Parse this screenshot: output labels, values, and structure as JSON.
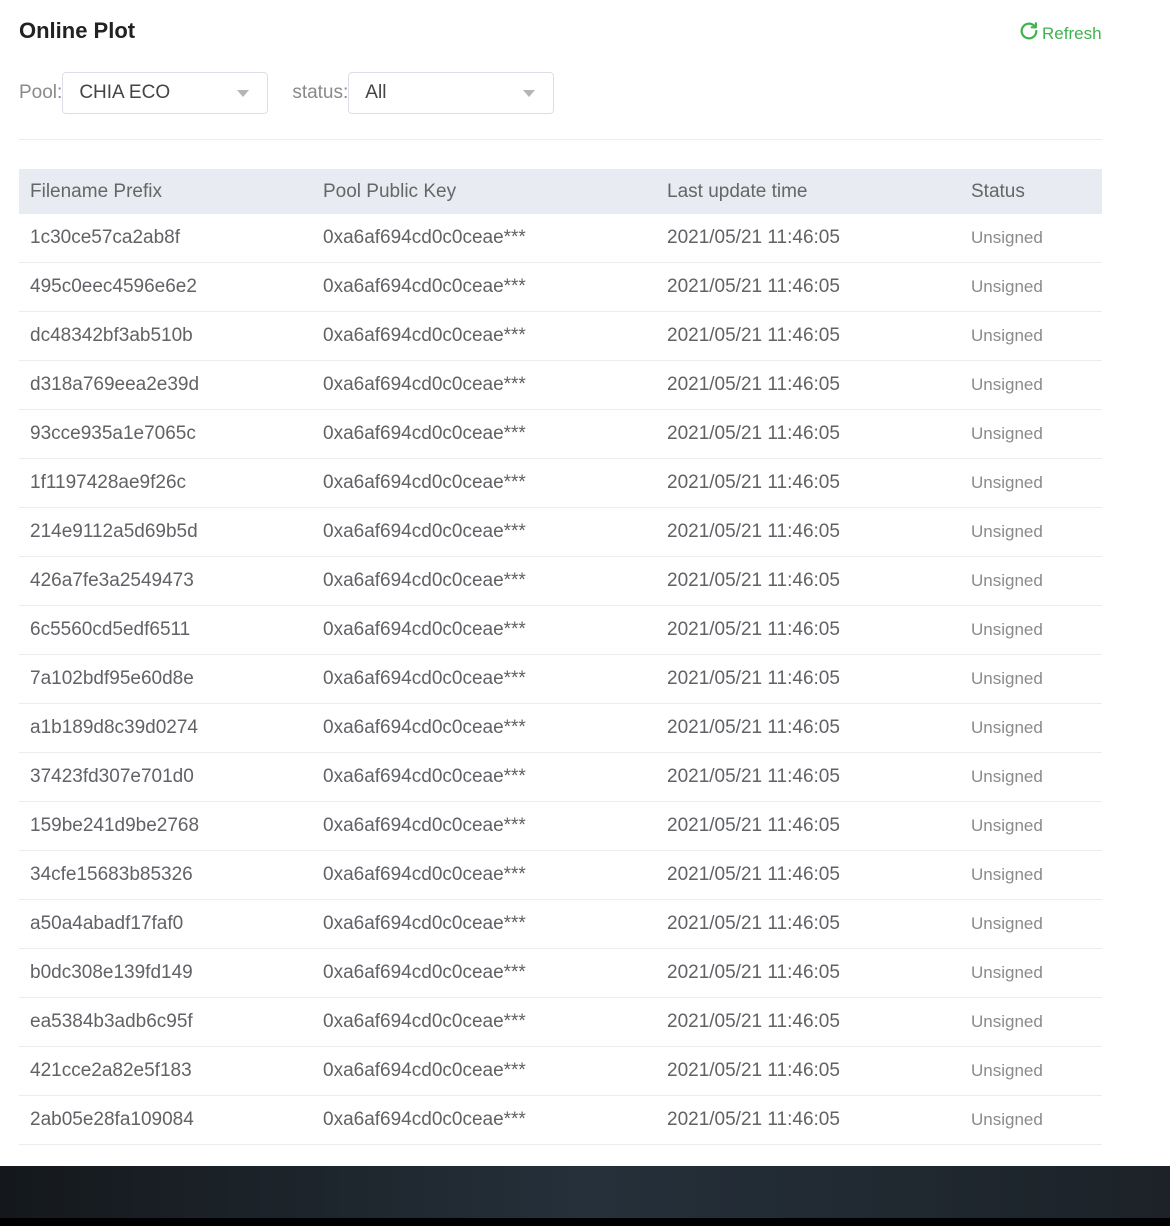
{
  "header": {
    "title": "Online Plot",
    "refresh_label": "Refresh"
  },
  "filters": {
    "pool": {
      "label": "Pool:",
      "value": "CHIA ECO"
    },
    "status": {
      "label": "status:",
      "value": "All"
    }
  },
  "colors": {
    "accent": "#3fb34f",
    "header_bg": "#e8ebf1"
  },
  "table": {
    "columns": [
      "Filename Prefix",
      "Pool Public Key",
      "Last update time",
      "Status"
    ],
    "rows": [
      [
        "1c30ce57ca2ab8f",
        "0xa6af694cd0c0ceae***",
        "2021/05/21 11:46:05",
        "Unsigned"
      ],
      [
        "495c0eec4596e6e2",
        "0xa6af694cd0c0ceae***",
        "2021/05/21 11:46:05",
        "Unsigned"
      ],
      [
        "dc48342bf3ab510b",
        "0xa6af694cd0c0ceae***",
        "2021/05/21 11:46:05",
        "Unsigned"
      ],
      [
        "d318a769eea2e39d",
        "0xa6af694cd0c0ceae***",
        "2021/05/21 11:46:05",
        "Unsigned"
      ],
      [
        "93cce935a1e7065c",
        "0xa6af694cd0c0ceae***",
        "2021/05/21 11:46:05",
        "Unsigned"
      ],
      [
        "1f1197428ae9f26c",
        "0xa6af694cd0c0ceae***",
        "2021/05/21 11:46:05",
        "Unsigned"
      ],
      [
        "214e9112a5d69b5d",
        "0xa6af694cd0c0ceae***",
        "2021/05/21 11:46:05",
        "Unsigned"
      ],
      [
        "426a7fe3a2549473",
        "0xa6af694cd0c0ceae***",
        "2021/05/21 11:46:05",
        "Unsigned"
      ],
      [
        "6c5560cd5edf6511",
        "0xa6af694cd0c0ceae***",
        "2021/05/21 11:46:05",
        "Unsigned"
      ],
      [
        "7a102bdf95e60d8e",
        "0xa6af694cd0c0ceae***",
        "2021/05/21 11:46:05",
        "Unsigned"
      ],
      [
        "a1b189d8c39d0274",
        "0xa6af694cd0c0ceae***",
        "2021/05/21 11:46:05",
        "Unsigned"
      ],
      [
        "37423fd307e701d0",
        "0xa6af694cd0c0ceae***",
        "2021/05/21 11:46:05",
        "Unsigned"
      ],
      [
        "159be241d9be2768",
        "0xa6af694cd0c0ceae***",
        "2021/05/21 11:46:05",
        "Unsigned"
      ],
      [
        "34cfe15683b85326",
        "0xa6af694cd0c0ceae***",
        "2021/05/21 11:46:05",
        "Unsigned"
      ],
      [
        "a50a4abadf17faf0",
        "0xa6af694cd0c0ceae***",
        "2021/05/21 11:46:05",
        "Unsigned"
      ],
      [
        "b0dc308e139fd149",
        "0xa6af694cd0c0ceae***",
        "2021/05/21 11:46:05",
        "Unsigned"
      ],
      [
        "ea5384b3adb6c95f",
        "0xa6af694cd0c0ceae***",
        "2021/05/21 11:46:05",
        "Unsigned"
      ],
      [
        "421cce2a82e5f183",
        "0xa6af694cd0c0ceae***",
        "2021/05/21 11:46:05",
        "Unsigned"
      ],
      [
        "2ab05e28fa109084",
        "0xa6af694cd0c0ceae***",
        "2021/05/21 11:46:05",
        "Unsigned"
      ],
      [
        "",
        "",
        "",
        ""
      ]
    ]
  }
}
